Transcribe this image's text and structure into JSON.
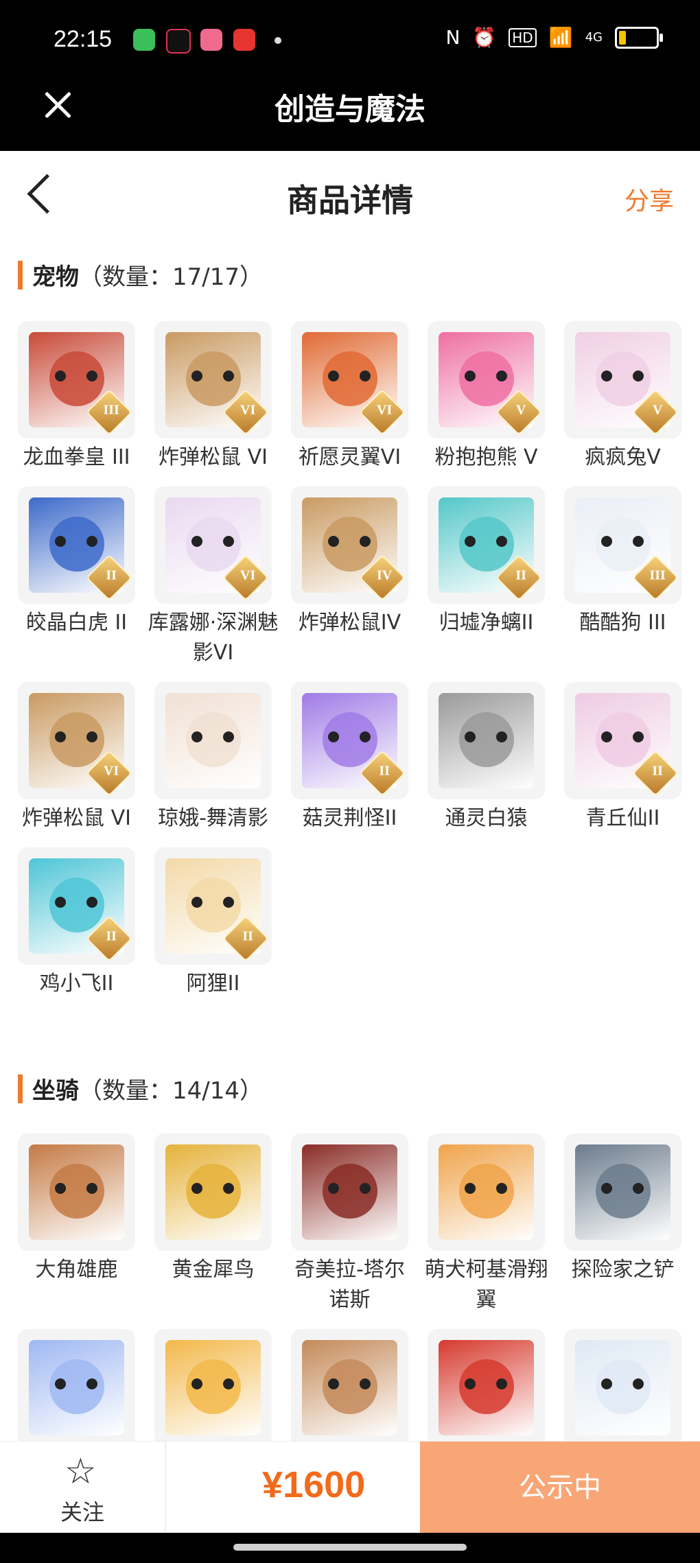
{
  "status_bar": {
    "time": "22:15",
    "network": "4G",
    "hd": "HD"
  },
  "app": {
    "title": "创造与魔法"
  },
  "page": {
    "title": "商品详情",
    "share": "分享"
  },
  "sections": [
    {
      "name": "宠物",
      "count": "（数量：17/17）",
      "items": [
        {
          "label": "龙血拳皇 III",
          "tier": "III",
          "color": "#c84a38"
        },
        {
          "label": "炸弹松鼠 VI",
          "tier": "VI",
          "color": "#c99a62"
        },
        {
          "label": "祈愿灵翼VI",
          "tier": "VI",
          "color": "#e06a34"
        },
        {
          "label": "粉抱抱熊 V",
          "tier": "V",
          "color": "#ee6fa2"
        },
        {
          "label": "疯疯兔V",
          "tier": "V",
          "color": "#f0cfe4"
        },
        {
          "label": "皎晶白虎 II",
          "tier": "II",
          "color": "#3d6ac9"
        },
        {
          "label": "库露娜·深渊魅影VI",
          "tier": "VI",
          "color": "#e9d9f0"
        },
        {
          "label": "炸弹松鼠IV",
          "tier": "IV",
          "color": "#c99a62"
        },
        {
          "label": "归墟净螭II",
          "tier": "II",
          "color": "#55c7c8"
        },
        {
          "label": "酷酷狗 III",
          "tier": "III",
          "color": "#eaeef6"
        },
        {
          "label": "炸弹松鼠 VI",
          "tier": "VI",
          "color": "#c99a62"
        },
        {
          "label": "琼娥-舞清影",
          "tier": "",
          "color": "#f1e0d4"
        },
        {
          "label": "菇灵荆怪II",
          "tier": "II",
          "color": "#a07be6"
        },
        {
          "label": "通灵白猿",
          "tier": "",
          "color": "#9a9a9a"
        },
        {
          "label": "青丘仙II",
          "tier": "II",
          "color": "#eecbe3"
        },
        {
          "label": "鸡小飞II",
          "tier": "II",
          "color": "#4fc5d6"
        },
        {
          "label": "阿狸II",
          "tier": "II",
          "color": "#f3d9a8"
        }
      ]
    },
    {
      "name": "坐骑",
      "count": "（数量：14/14）",
      "items": [
        {
          "label": "大角雄鹿",
          "tier": "",
          "color": "#c47a44"
        },
        {
          "label": "黄金犀鸟",
          "tier": "",
          "color": "#e5b23a"
        },
        {
          "label": "奇美拉-塔尔诺斯",
          "tier": "",
          "color": "#8a2c26"
        },
        {
          "label": "萌犬柯基滑翔翼",
          "tier": "",
          "color": "#f0a34a"
        },
        {
          "label": "探险家之铲",
          "tier": "",
          "color": "#6b7b8c"
        },
        {
          "label": "",
          "tier": "",
          "color": "#9fb8f2"
        },
        {
          "label": "",
          "tier": "",
          "color": "#f2b84a"
        },
        {
          "label": "",
          "tier": "",
          "color": "#c48a5a"
        },
        {
          "label": "",
          "tier": "",
          "color": "#d63a2e"
        },
        {
          "label": "",
          "tier": "",
          "color": "#dfe9f4"
        }
      ]
    }
  ],
  "bottom_bar": {
    "follow_label": "关注",
    "price": "¥1600",
    "status": "公示中"
  },
  "colors": {
    "accent": "#ee7a2d",
    "price": "#f26a1b",
    "status_button": "#f9a676"
  }
}
